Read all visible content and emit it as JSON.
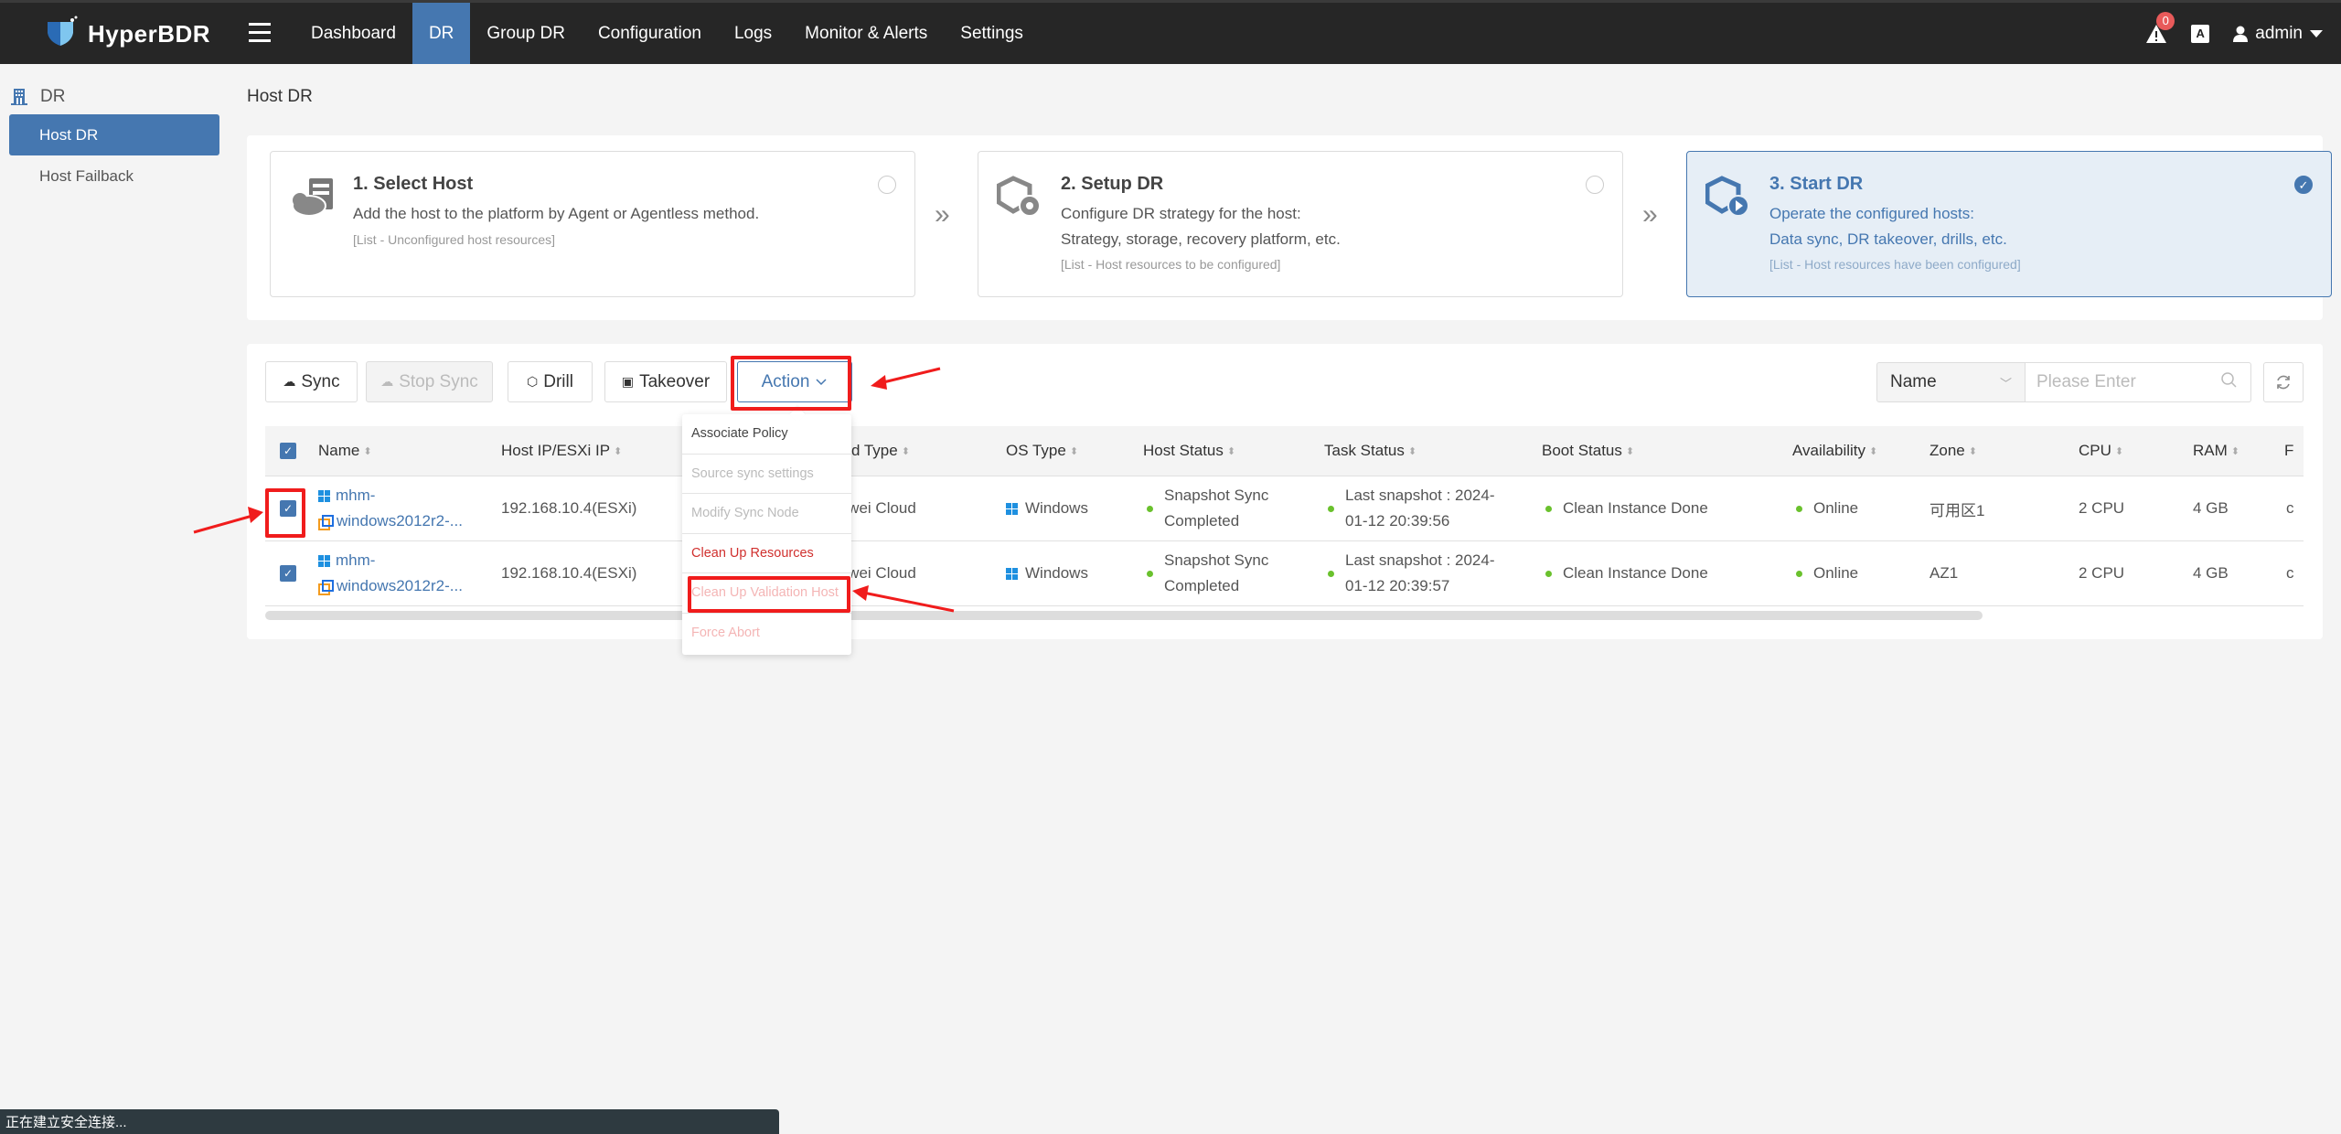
{
  "app": {
    "name": "HyperBDR"
  },
  "nav": {
    "items": [
      {
        "label": "Dashboard",
        "active": false
      },
      {
        "label": "DR",
        "active": true
      },
      {
        "label": "Group DR",
        "active": false
      },
      {
        "label": "Configuration",
        "active": false
      },
      {
        "label": "Logs",
        "active": false
      },
      {
        "label": "Monitor & Alerts",
        "active": false
      },
      {
        "label": "Settings",
        "active": false
      }
    ],
    "alert_count": "0",
    "lang_icon_label": "A",
    "user": "admin"
  },
  "sidebar": {
    "section": "DR",
    "items": [
      {
        "label": "Host DR",
        "active": true
      },
      {
        "label": "Host Failback",
        "active": false
      }
    ]
  },
  "page": {
    "title": "Host DR"
  },
  "steps": [
    {
      "title": "1. Select Host",
      "lines": [
        "Add the host to the platform by Agent or Agentless method."
      ],
      "note": "[List - Unconfigured host resources]",
      "selected": false,
      "icon": "cloud-server-icon"
    },
    {
      "title": "2. Setup DR",
      "lines": [
        "Configure DR strategy for the host:",
        "Strategy, storage, recovery platform, etc."
      ],
      "note": "[List - Host resources to be configured]",
      "selected": false,
      "icon": "box-gear-icon"
    },
    {
      "title": "3. Start DR",
      "lines": [
        "Operate the configured hosts:",
        "Data sync, DR takeover, drills, etc."
      ],
      "note": "[List - Host resources have been configured]",
      "selected": true,
      "icon": "box-play-icon"
    }
  ],
  "toolbar": {
    "sync": "Sync",
    "stop_sync": "Stop Sync",
    "drill": "Drill",
    "takeover": "Takeover",
    "action": "Action"
  },
  "search": {
    "field_selected": "Name",
    "placeholder": "Please Enter"
  },
  "action_menu": [
    {
      "label": "Associate Policy",
      "state": "normal"
    },
    {
      "label": "Source sync settings",
      "state": "disabled"
    },
    {
      "label": "Modify Sync Node",
      "state": "disabled"
    },
    {
      "label": "Clean Up Resources",
      "state": "danger"
    },
    {
      "label": "Clean Up Validation Host",
      "state": "danger-disabled"
    },
    {
      "label": "Force Abort",
      "state": "danger-disabled"
    }
  ],
  "table": {
    "columns": [
      "Name",
      "Host IP/ESXi IP",
      "Cloud Type",
      "OS Type",
      "Host Status",
      "Task Status",
      "Boot Status",
      "Availability",
      "Zone",
      "CPU",
      "RAM",
      "F"
    ],
    "visible_cloud_header": "ud Type",
    "rows": [
      {
        "checked": true,
        "name_line1": "mhm-",
        "name_line2": "windows2012r2-...",
        "ip": "192.168.10.4(ESXi)",
        "cloud": "Huawei Cloud",
        "cloud_visible": "Huawei Cloud",
        "os": "Windows",
        "host_status_1": "Snapshot Sync",
        "host_status_2": "Completed",
        "task_status_1": "Last snapshot : 2024-",
        "task_status_2": "01-12 20:39:56",
        "boot_status": "Clean Instance Done",
        "availability": "Online",
        "zone": "可用区1",
        "cpu": "2 CPU",
        "ram": "4 GB",
        "extra": "c"
      },
      {
        "checked": true,
        "name_line1": "mhm-",
        "name_line2": "windows2012r2-...",
        "ip": "192.168.10.4(ESXi)",
        "cloud": "Huawei Cloud",
        "cloud_visible": "Huawei Cloud",
        "os": "Windows",
        "host_status_1": "Snapshot Sync",
        "host_status_2": "Completed",
        "task_status_1": "Last snapshot : 2024-",
        "task_status_2": "01-12 20:39:57",
        "boot_status": "Clean Instance Done",
        "availability": "Online",
        "zone": "AZ1",
        "cpu": "2 CPU",
        "ram": "4 GB",
        "extra": "c"
      }
    ]
  },
  "statusbar": {
    "text": "正在建立安全连接..."
  },
  "colors": {
    "accent": "#4577b0",
    "topbar": "#262626",
    "online": "#6ac12d",
    "danger": "#d0302e",
    "annotation": "#f01c1c"
  }
}
